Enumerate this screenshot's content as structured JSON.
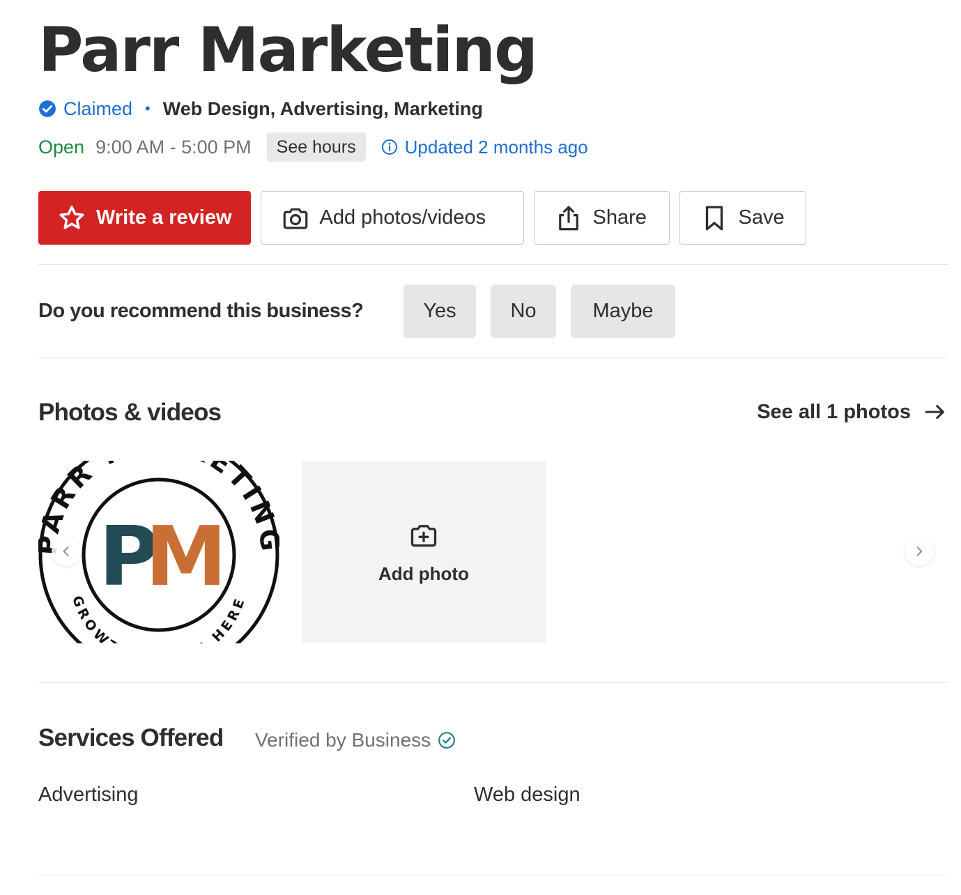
{
  "business": {
    "name": "Parr Marketing",
    "claimed_label": "Claimed",
    "separator": "•",
    "categories": "Web Design, Advertising, Marketing",
    "status": "Open",
    "hours": "9:00 AM - 5:00 PM",
    "see_hours_label": "See hours",
    "updated_label": "Updated 2 months ago"
  },
  "actions": {
    "write_review": "Write a review",
    "add_photos": "Add photos/videos",
    "share": "Share",
    "save": "Save"
  },
  "recommend": {
    "question": "Do you recommend this business?",
    "yes": "Yes",
    "no": "No",
    "maybe": "Maybe"
  },
  "photos": {
    "title": "Photos & videos",
    "see_all": "See all 1 photos",
    "add_photo": "Add photo",
    "logo": {
      "initial_p": "P",
      "initial_m": "M",
      "ring_top": "PARR MARKETING",
      "ring_bottom": "GROWTH STARTS HERE"
    }
  },
  "services": {
    "title": "Services Offered",
    "verified_label": "Verified by Business",
    "items": [
      "Advertising",
      "Web design"
    ]
  },
  "colors": {
    "brand_red": "#d32323",
    "link_blue": "#1d6fd1",
    "open_green": "#1f8a3c",
    "logo_teal": "#234b55",
    "logo_orange": "#c96f35",
    "verified_teal": "#2a7b8c"
  }
}
